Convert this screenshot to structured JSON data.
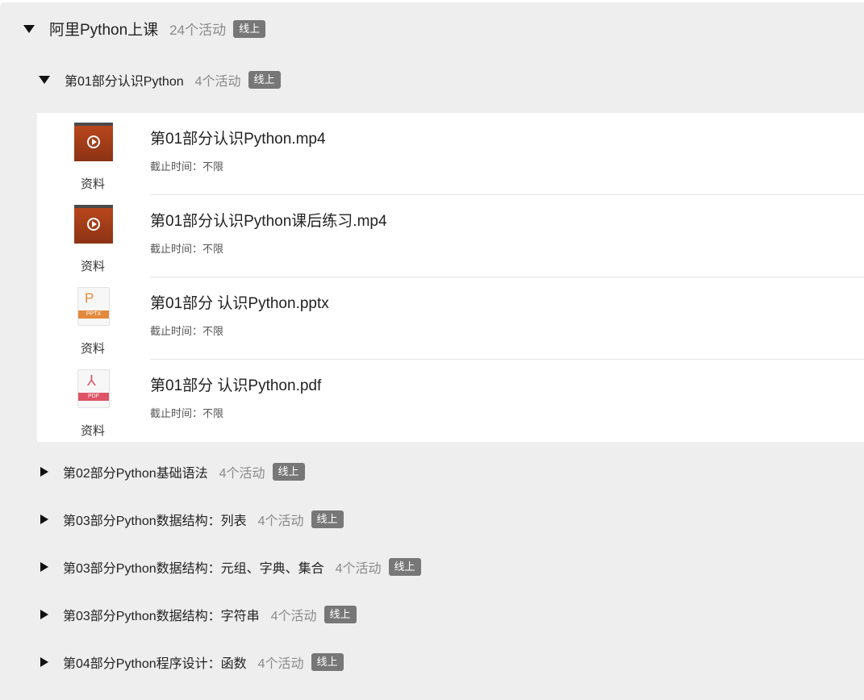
{
  "course": {
    "title": "阿里Python上课",
    "count": "24个活动",
    "badge": "线上"
  },
  "section_open": {
    "title": "第01部分认识Python",
    "count": "4个活动",
    "badge": "线上",
    "items": [
      {
        "name": "第01部分认识Python.mp4",
        "deadline": "截止时间：不限",
        "kind": "资料",
        "icon": "video-icon"
      },
      {
        "name": "第01部分认识Python课后练习.mp4",
        "deadline": "截止时间：不限",
        "kind": "资料",
        "icon": "video-icon"
      },
      {
        "name": "第01部分 认识Python.pptx",
        "deadline": "截止时间：不限",
        "kind": "资料",
        "icon": "pptx-file-icon",
        "icon_letter": "P",
        "icon_band": "PPTX"
      },
      {
        "name": "第01部分 认识Python.pdf",
        "deadline": "截止时间：不限",
        "kind": "资料",
        "icon": "pdf-file-icon",
        "icon_letter": "⅄",
        "icon_band": "PDF"
      }
    ]
  },
  "sections_collapsed": [
    {
      "title": "第02部分Python基础语法",
      "count": "4个活动",
      "badge": "线上"
    },
    {
      "title": "第03部分Python数据结构：列表",
      "count": "4个活动",
      "badge": "线上"
    },
    {
      "title": "第03部分Python数据结构：元组、字典、集合",
      "count": "4个活动",
      "badge": "线上"
    },
    {
      "title": "第03部分Python数据结构：字符串",
      "count": "4个活动",
      "badge": "线上"
    },
    {
      "title": "第04部分Python程序设计：函数",
      "count": "4个活动",
      "badge": "线上"
    }
  ],
  "colors": {
    "panel_bg": "#eeeeee",
    "badge_bg": "#777777",
    "pptx_accent": "#e3893b",
    "pdf_accent": "#dd5566",
    "video_thumb": "#b8461c"
  }
}
